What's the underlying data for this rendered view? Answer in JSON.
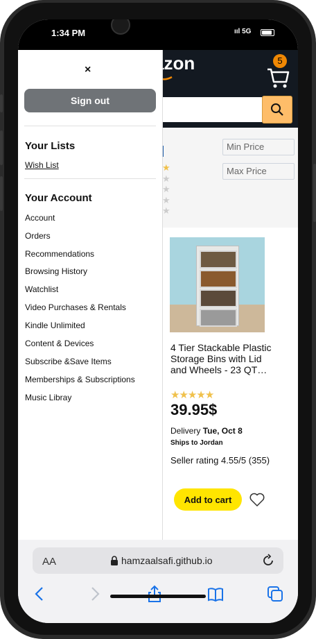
{
  "status_bar": {
    "time": "1:34 PM",
    "network": "5G"
  },
  "header": {
    "logo_text": "azon",
    "cart_count": "5"
  },
  "filters": {
    "min_price_placeholder": "Min Price",
    "max_price_placeholder": "Max Price"
  },
  "menu": {
    "close_label": "×",
    "sign_out_label": "Sign out",
    "lists_title": "Your Lists",
    "wish_list": "Wish List",
    "account_title": "Your Account",
    "account_items": [
      "Account",
      "Orders",
      "Recommendations",
      "Browsing History",
      "Watchlist",
      "Video Purchases & Rentals",
      "Kindle Unlimited",
      "Content & Devices",
      "Subscribe &Save Items",
      "Memberships & Subscriptions",
      "Music Libray"
    ]
  },
  "product": {
    "title": "4 Tier Stackable Plastic Storage Bins with Lid and Wheels - 23 QT…",
    "rating_stars": 5,
    "price": "39.95$",
    "delivery_prefix": "Delivery ",
    "delivery_date": "Tue, Oct 8",
    "ships_to": "Ships to Jordan",
    "seller_rating": "Seller rating 4.55/5 (355)",
    "add_to_cart": "Add to cart"
  },
  "browser": {
    "font_size_label": "AA",
    "url": "hamzaalsafi.github.io"
  },
  "colors": {
    "header_bg": "#131921",
    "search_button": "#febd69",
    "add_to_cart": "#ffe500",
    "cart_badge": "#f08804",
    "star": "#f0c14b"
  }
}
